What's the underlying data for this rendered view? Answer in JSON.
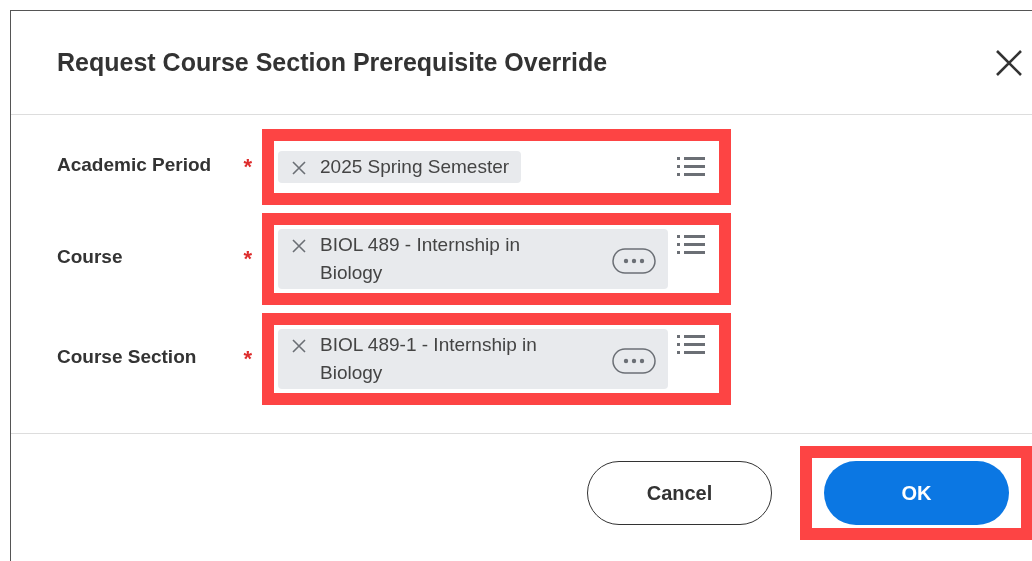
{
  "dialog": {
    "title": "Request Course Section Prerequisite Override"
  },
  "fields": [
    {
      "label": "Academic Period",
      "required_mark": "*",
      "value": "2025 Spring Semester",
      "related_actions": false,
      "highlighted": true
    },
    {
      "label": "Course",
      "required_mark": "*",
      "value": "BIOL 489 - Internship in Biology",
      "related_actions": true,
      "highlighted": true
    },
    {
      "label": "Course Section",
      "required_mark": "*",
      "value": "BIOL 489-1 - Internship in Biology",
      "related_actions": true,
      "highlighted": true
    }
  ],
  "buttons": [
    {
      "label": "Cancel",
      "kind": "secondary",
      "highlighted": false
    },
    {
      "label": "OK",
      "kind": "primary",
      "highlighted": true
    }
  ]
}
